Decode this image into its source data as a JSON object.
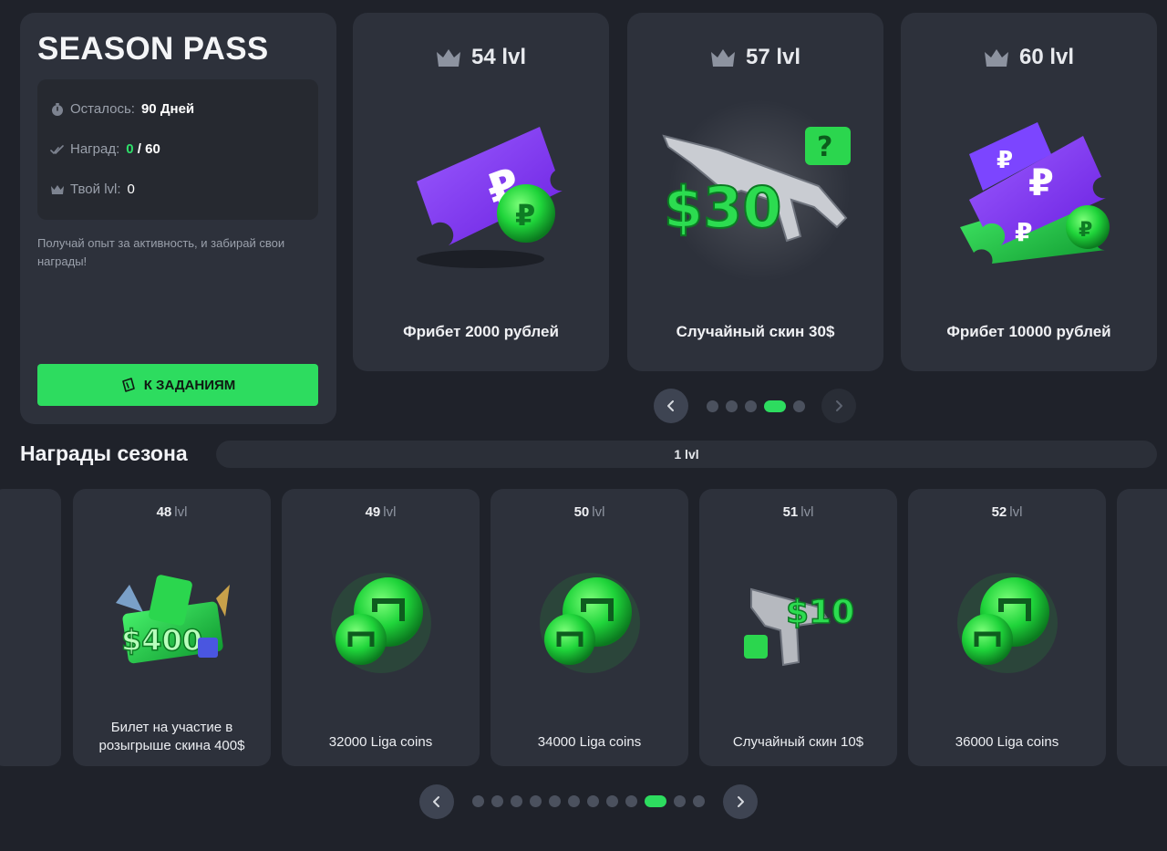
{
  "season_pass": {
    "title": "SEASON PASS",
    "remaining_label": "Осталось:",
    "remaining_value": "90 Дней",
    "rewards_label": "Наград:",
    "rewards_done": "0",
    "rewards_total": "/ 60",
    "level_label": "Твой lvl:",
    "level_value": "0",
    "description": "Получай опыт за активность, и забирай свои награды!",
    "button_label": "К ЗАДАНИЯМ"
  },
  "featured": {
    "cards": [
      {
        "level": "54 lvl",
        "name": "Фрибет 2000 рублей"
      },
      {
        "level": "57 lvl",
        "name": "Случайный скин 30$",
        "price": "$30"
      },
      {
        "level": "60 lvl",
        "name": "Фрибет 10000 рублей"
      }
    ],
    "pager": {
      "total": 5,
      "active": 4
    }
  },
  "season_rewards": {
    "title": "Награды сезона",
    "current_level": "1 lvl",
    "level_unit": "lvl",
    "cards": [
      {
        "level": "48",
        "name": "Билет на участие в розыгрыше скина 400$",
        "price": "$400"
      },
      {
        "level": "49",
        "name": "32000 Liga coins"
      },
      {
        "level": "50",
        "name": "34000 Liga coins"
      },
      {
        "level": "51",
        "name": "Случайный скин 10$",
        "price": "$10"
      },
      {
        "level": "52",
        "name": "36000 Liga coins"
      }
    ],
    "pager": {
      "total": 12,
      "active": 10
    }
  },
  "colors": {
    "accent": "#2ddc5f",
    "card": "#2d313b",
    "background": "#1f222a"
  },
  "icons": [
    "crown-icon",
    "timer-icon",
    "check-icon",
    "ticket-icon",
    "chevron-left-icon",
    "chevron-right-icon"
  ]
}
